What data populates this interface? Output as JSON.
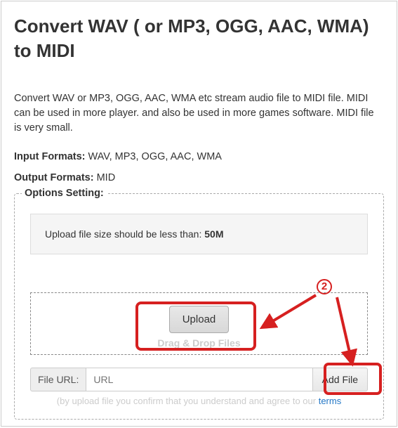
{
  "page": {
    "title": "Convert WAV ( or MP3, OGG, AAC, WMA) to MIDI",
    "description": "Convert WAV or MP3, OGG, AAC, WMA etc stream audio file to MIDI file. MIDI can be used in more player. and also be used in more games software. MIDI file is very small.",
    "input_formats_label": "Input Formats:",
    "input_formats_value": " WAV, MP3, OGG, AAC, WMA",
    "output_formats_label": "Output Formats:",
    "output_formats_value": " MID"
  },
  "options": {
    "title": "Options Setting:",
    "notice_prefix": "Upload file size should be less than: ",
    "notice_value": "50M",
    "upload_button": "Upload",
    "drop_text": "Drag & Drop Files",
    "url_label": "File URL:",
    "url_placeholder": "URL",
    "addfile_button": "Add File",
    "confirm_prefix": "(by upload file you confirm that you understand and agree to our ",
    "confirm_link": "terms"
  },
  "annotation": {
    "step": "2"
  }
}
